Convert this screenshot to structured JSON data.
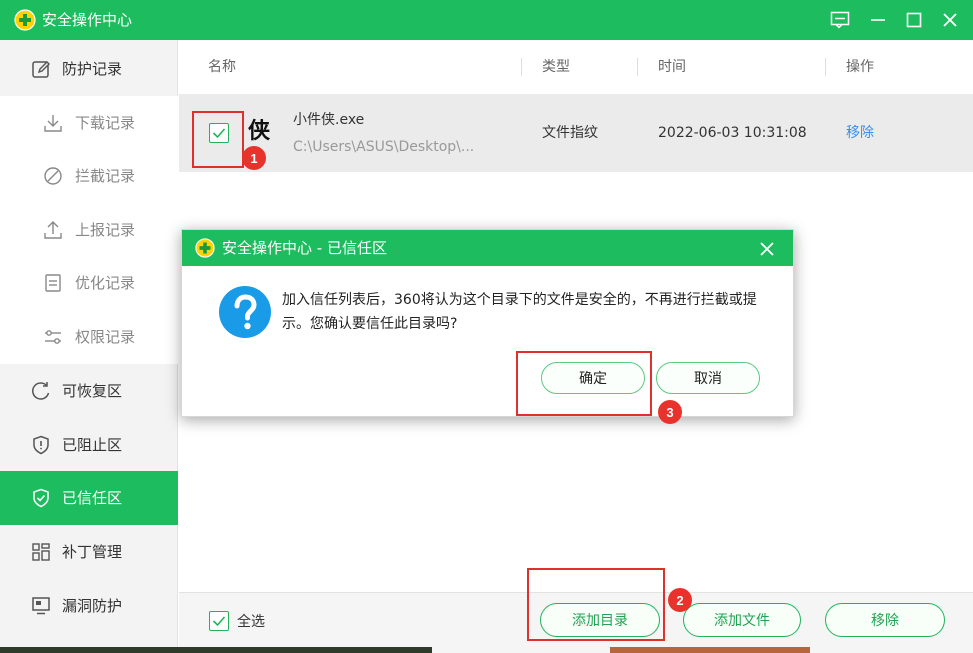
{
  "window": {
    "title": "安全操作中心"
  },
  "sidebar": {
    "items": [
      {
        "label": "防护记录",
        "icon": "edit-icon"
      },
      {
        "label": "下载记录",
        "icon": "download-icon"
      },
      {
        "label": "拦截记录",
        "icon": "block-icon"
      },
      {
        "label": "上报记录",
        "icon": "upload-icon"
      },
      {
        "label": "优化记录",
        "icon": "document-icon"
      },
      {
        "label": "权限记录",
        "icon": "sliders-icon"
      },
      {
        "label": "可恢复区",
        "icon": "restore-icon"
      },
      {
        "label": "已阻止区",
        "icon": "shield-alert-icon"
      },
      {
        "label": "已信任区",
        "icon": "shield-check-icon"
      },
      {
        "label": "补丁管理",
        "icon": "grid-icon"
      },
      {
        "label": "漏洞防护",
        "icon": "monitor-icon"
      }
    ],
    "active": "已信任区"
  },
  "table": {
    "columns": [
      "名称",
      "类型",
      "时间",
      "操作"
    ],
    "rows": [
      {
        "icon_char": "侠",
        "name": "小件侠.exe",
        "path": "C:\\Users\\ASUS\\Desktop\\...",
        "type": "文件指纹",
        "time": "2022-06-03 10:31:08",
        "action": "移除",
        "checked": true
      }
    ]
  },
  "footer": {
    "select_all": "全选",
    "buttons": {
      "add_dir": "添加目录",
      "add_file": "添加文件",
      "remove": "移除"
    }
  },
  "dialog": {
    "title": "安全操作中心 - 已信任区",
    "message": "加入信任列表后，360将认为这个目录下的文件是安全的，不再进行拦截或提示。您确认要信任此目录吗?",
    "ok": "确定",
    "cancel": "取消"
  },
  "annotations": [
    "1",
    "2",
    "3"
  ],
  "colors": {
    "accent": "#1dbd5f",
    "link": "#3a8ee6",
    "annotation": "#e0302b"
  }
}
